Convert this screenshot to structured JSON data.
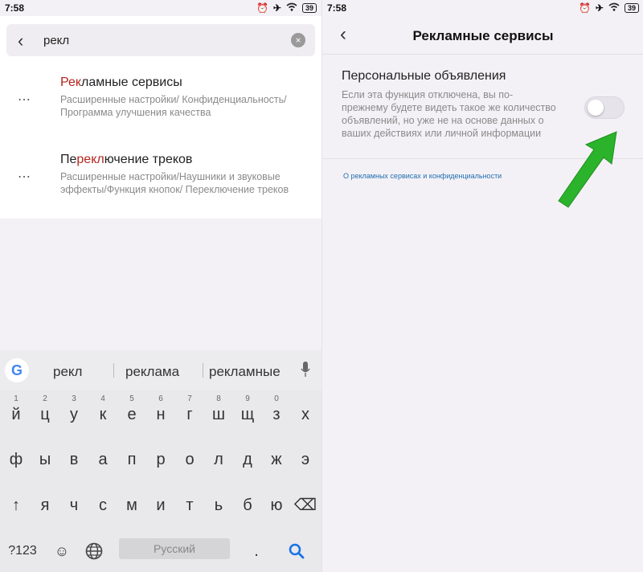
{
  "left": {
    "status": {
      "time": "7:58",
      "battery": "39"
    },
    "search": {
      "query": "рекл",
      "back_glyph": "‹",
      "clear_glyph": "×"
    },
    "results": [
      {
        "title_pre": "",
        "title_hl": "Рек",
        "title_post": "ламные сервисы",
        "subtitle": "Расширенные настройки/ Конфиденциальность/Программа улучшения качества"
      },
      {
        "title_pre": "Пе",
        "title_hl": "рекл",
        "title_post": "ючение треков",
        "subtitle": "Расширенные настройки/Наушники и звуковые эффекты/Функция кнопок/ Переключение треков"
      }
    ],
    "keyboard": {
      "logo": "G",
      "suggestions": [
        "рекл",
        "реклама",
        "рекламные"
      ],
      "row1": [
        "й",
        "ц",
        "у",
        "к",
        "е",
        "н",
        "г",
        "ш",
        "щ",
        "з",
        "х"
      ],
      "row1_hints": [
        "1",
        "2",
        "3",
        "4",
        "5",
        "6",
        "7",
        "8",
        "9",
        "0",
        ""
      ],
      "row2": [
        "ф",
        "ы",
        "в",
        "а",
        "п",
        "р",
        "о",
        "л",
        "д",
        "ж",
        "э"
      ],
      "row3": [
        "↑",
        "я",
        "ч",
        "с",
        "м",
        "и",
        "т",
        "ь",
        "б",
        "ю",
        "⌫"
      ],
      "bottom": {
        "sym": "?123",
        "emoji": "☺",
        "globe": "🌐",
        "space": "Русский",
        "period": ".",
        "search": "🔍"
      }
    }
  },
  "right": {
    "status": {
      "time": "7:58",
      "battery": "39"
    },
    "header": {
      "back_glyph": "‹",
      "title": "Рекламные сервисы"
    },
    "setting": {
      "title": "Персональные объявления",
      "description": "Если эта функция отключена, вы по-прежнему будете видеть такое же количество объявлений, но уже не на основе данных о ваших действиях или личной информации",
      "enabled": false
    },
    "link": "О рекламных сервисах и конфиденциальности"
  },
  "colors": {
    "highlight": "#b3261e",
    "link": "#1f6fb0",
    "arrow": "#2bb32b"
  }
}
